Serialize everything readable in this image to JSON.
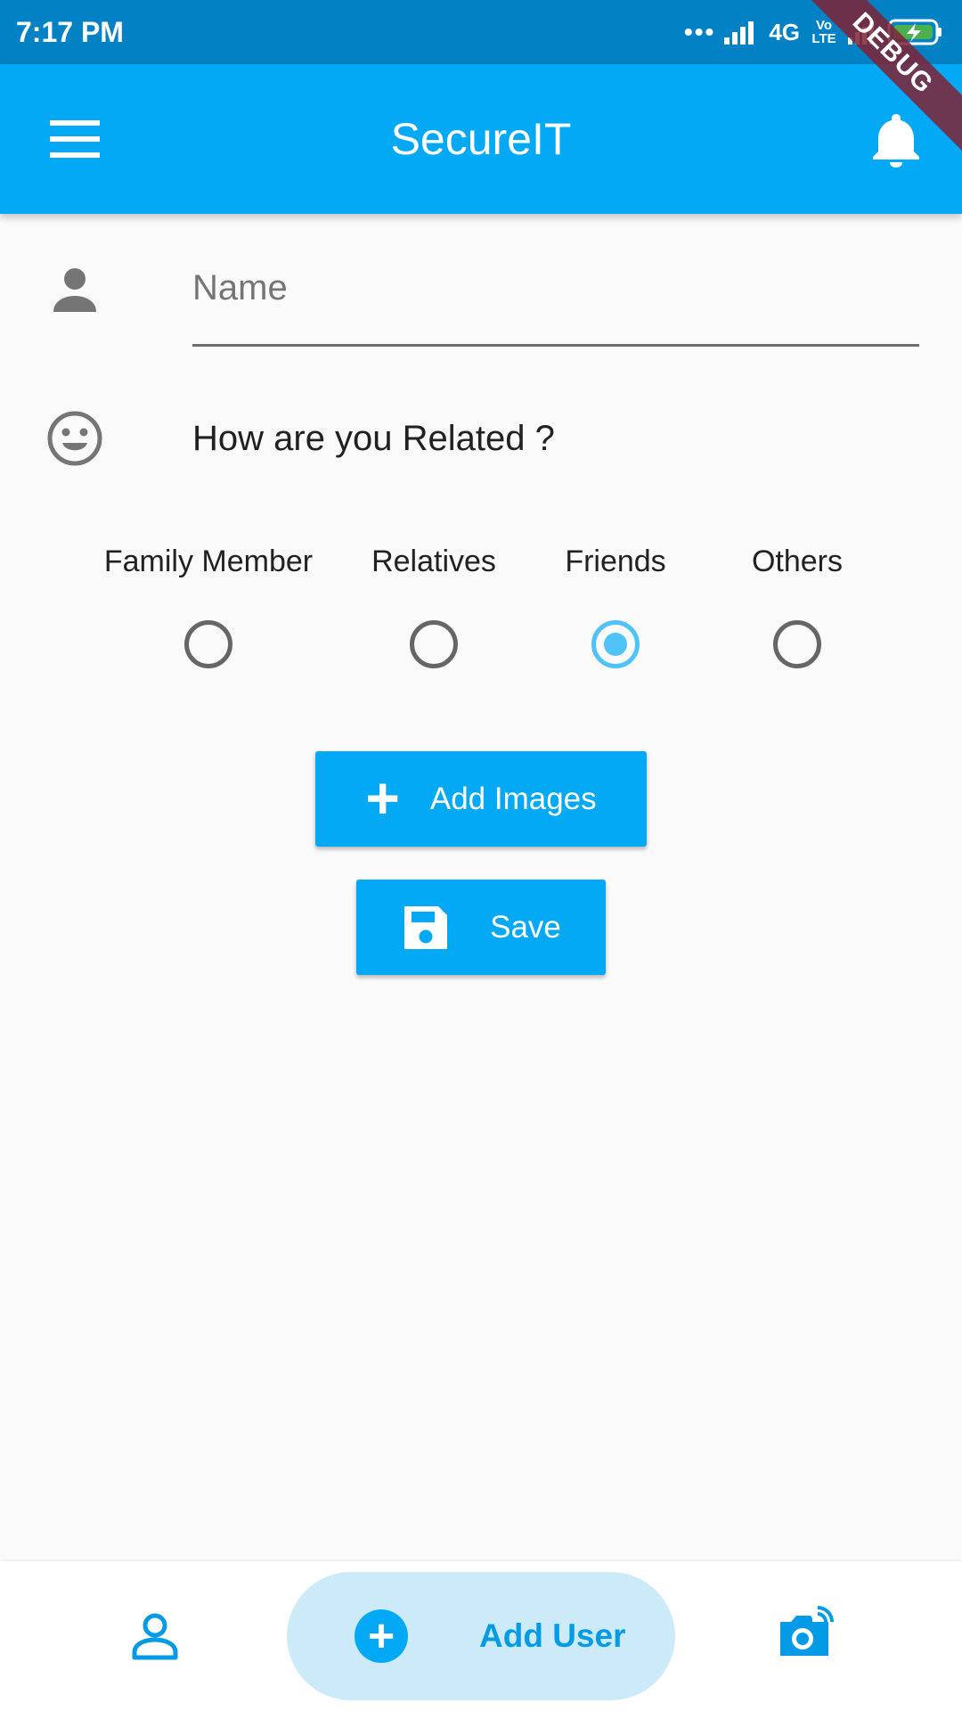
{
  "status_bar": {
    "time": "7:17 PM",
    "dots": "•••",
    "network": "4G",
    "volte": "Vo LTE"
  },
  "debug_banner": "DEBUG",
  "app_bar": {
    "title": "SecureIT",
    "menu_icon": "hamburger-menu-icon",
    "notification_icon": "bell-icon"
  },
  "form": {
    "name_field": {
      "placeholder": "Name",
      "value": "",
      "icon": "person-icon"
    },
    "relation": {
      "icon": "smiley-icon",
      "question": "How are you Related ?",
      "options": [
        {
          "label": "Family Member",
          "selected": false
        },
        {
          "label": "Relatives",
          "selected": false
        },
        {
          "label": "Friends",
          "selected": true
        },
        {
          "label": "Others",
          "selected": false
        }
      ]
    },
    "add_images_button": {
      "label": "Add Images",
      "icon": "plus-icon"
    },
    "save_button": {
      "label": "Save",
      "icon": "floppy-disk-icon"
    }
  },
  "bottom_nav": {
    "items": [
      {
        "icon": "user-icon",
        "label": ""
      },
      {
        "icon": "add-circle-icon",
        "label": "Add User",
        "active": true
      },
      {
        "icon": "camera-icon",
        "label": ""
      }
    ]
  },
  "colors": {
    "status_bar": "#0381c5",
    "app_bar": "#03a9f4",
    "accent": "#03a9f4",
    "radio_selected": "#4fc3f7",
    "nav_pill": "#cdeaf9",
    "background": "#fafafa"
  }
}
